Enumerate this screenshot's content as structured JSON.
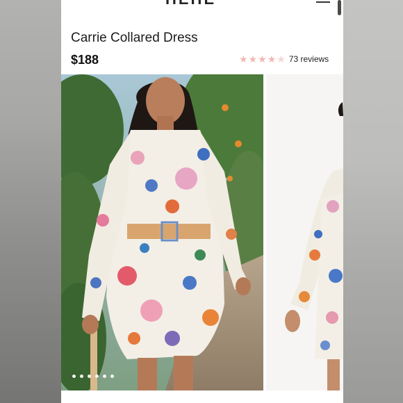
{
  "header": {
    "brand": "HEHE",
    "menu_icon": "hamburger-icon"
  },
  "product": {
    "title": "Carrie Collared Dress",
    "price": "$188",
    "rating_value": 4.5,
    "rating_max": 5,
    "reviews_label": "73 reviews"
  },
  "gallery": {
    "image_count": 6,
    "active_index": 0
  },
  "colors": {
    "star": "#f2b6b4",
    "text": "#1c1c1c"
  }
}
